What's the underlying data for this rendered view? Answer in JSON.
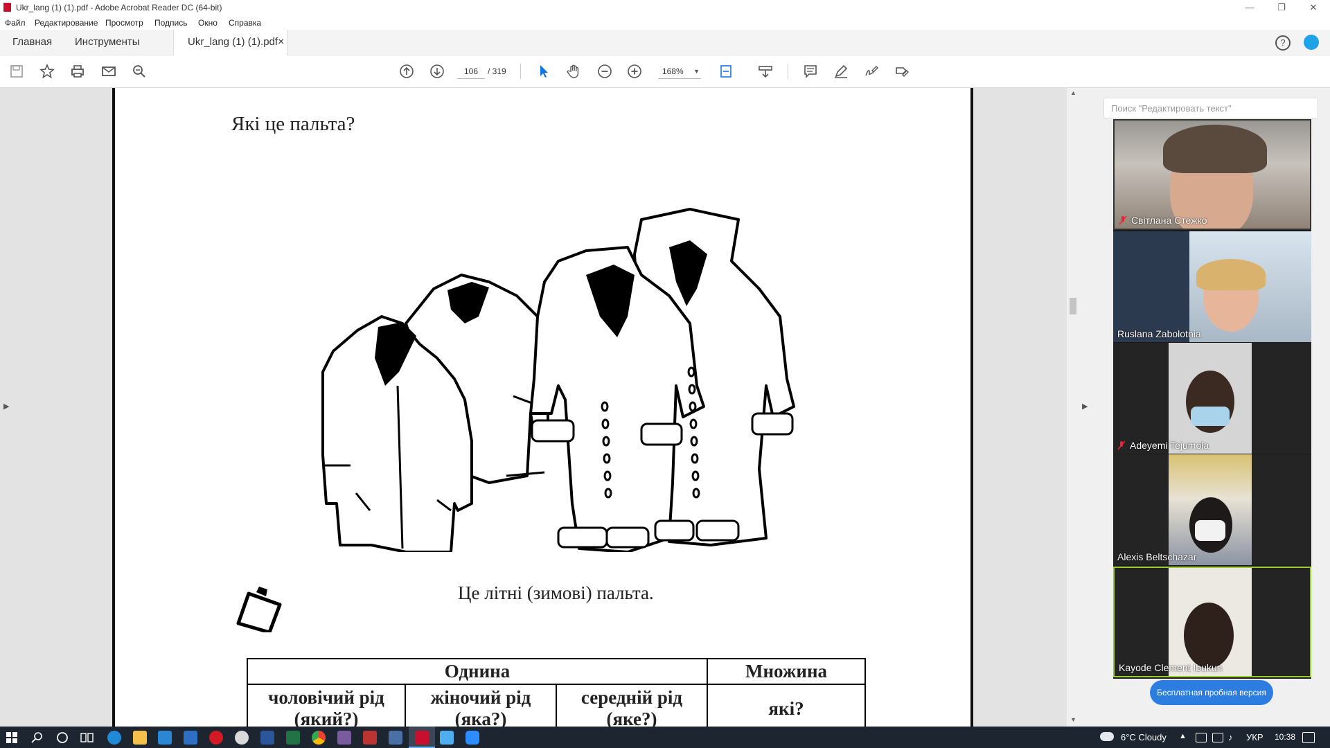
{
  "window": {
    "title": "Ukr_lang (1) (1).pdf - Adobe Acrobat Reader DC (64-bit)",
    "controls": [
      "—",
      "❐",
      "✕"
    ]
  },
  "menu": [
    "Файл",
    "Редактирование",
    "Просмотр",
    "Подпись",
    "Окно",
    "Справка"
  ],
  "tabs": {
    "home": "Главная",
    "tools": "Инструменты",
    "document": "Ukr_lang (1) (1).pdf",
    "close": "×"
  },
  "toolbar": {
    "page_current": "106",
    "page_total": "/ 319",
    "zoom": "168%",
    "icons": [
      "save-icon",
      "bookmark-star-icon",
      "print-icon",
      "email-icon",
      "search-zoom-icon",
      "page-up-icon",
      "page-down-icon",
      "select-arrow-icon",
      "hand-icon",
      "zoom-out-icon",
      "zoom-in-icon",
      "fit-page-icon",
      "scroll-mode-icon",
      "comment-icon",
      "highlight-pen-icon",
      "sign-icon",
      "edit-icon"
    ]
  },
  "document": {
    "question": "Які це пальта?",
    "caption": "Це літні (зимові) пальта.",
    "table": {
      "head_singular": "Однина",
      "head_plural": "Множина",
      "col1": "чоловічий рід (який?)",
      "col2": "жіночий рід (яка?)",
      "col3": "середній рід (яке?)",
      "col4": "які?"
    }
  },
  "right_panel": {
    "search_placeholder": "Поиск \"Редактировать текст\"",
    "trial_button": "Бесплатная пробная версия"
  },
  "zoom_participants": [
    {
      "name": "Світлана Стежко",
      "muted": true
    },
    {
      "name": "Ruslana Zabolotnia",
      "muted": false
    },
    {
      "name": "Adeyemi Tejumola",
      "muted": true
    },
    {
      "name": "Alexis Beltschazar",
      "muted": false
    },
    {
      "name": "Kayode Clement Ibukun",
      "muted": false
    }
  ],
  "taskbar": {
    "weather": "6°C  Cloudy",
    "language": "УКР",
    "time": "10:38"
  },
  "colors": {
    "acrobat_red": "#c8102e",
    "accent_blue": "#2d7ce0",
    "taskbar": "#1c2530",
    "active_speaker": "#9acd32"
  }
}
